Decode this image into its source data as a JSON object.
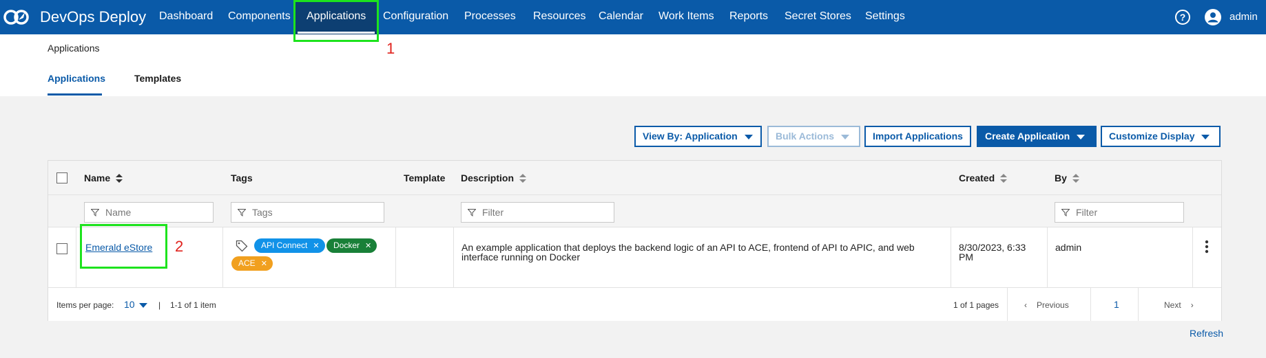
{
  "app": {
    "title": "DevOps Deploy"
  },
  "nav": {
    "items": [
      "Dashboard",
      "Components",
      "Applications",
      "Configuration",
      "Processes",
      "Resources",
      "Calendar",
      "Work Items",
      "Reports",
      "Secret Stores",
      "Settings"
    ],
    "active": "Applications",
    "user": "admin",
    "help_symbol": "?"
  },
  "breadcrumb": "Applications",
  "subtabs": [
    "Applications",
    "Templates"
  ],
  "toolbar": {
    "view_by": "View By: Application",
    "bulk_actions": "Bulk Actions",
    "import": "Import Applications",
    "create": "Create Application",
    "customize": "Customize Display"
  },
  "table": {
    "headers": {
      "name": "Name",
      "tags": "Tags",
      "template": "Template",
      "description": "Description",
      "created": "Created",
      "by": "By"
    },
    "filters": {
      "name": "Name",
      "tags": "Tags",
      "description": "Filter",
      "by": "Filter"
    },
    "row": {
      "name": "Emerald eStore",
      "tags": [
        {
          "label": "API Connect",
          "color": "#1192e8"
        },
        {
          "label": "Docker",
          "color": "#198038"
        },
        {
          "label": "ACE",
          "color": "#f1a01f"
        }
      ],
      "template": "",
      "description_line1": "An example application that deploys the backend logic of an API to ACE, frontend of API to APIC, and web",
      "description_line2": "interface running on Docker",
      "created_line1": "8/30/2023, 6:33",
      "created_line2": "PM",
      "by": "admin"
    },
    "pagination": {
      "items_per_page_label": "Items per page:",
      "items_per_page": "10",
      "separator": "|",
      "range": "1-1 of 1 item",
      "pages": "1 of 1 pages",
      "previous": "Previous",
      "current": "1",
      "next": "Next"
    }
  },
  "refresh": "Refresh",
  "annotations": [
    "1",
    "2"
  ],
  "colors": {
    "brand": "#0a5aa8",
    "nav_active": "#0d3f72",
    "annotation_box": "#1de31d",
    "annotation_number": "#e0221d"
  }
}
